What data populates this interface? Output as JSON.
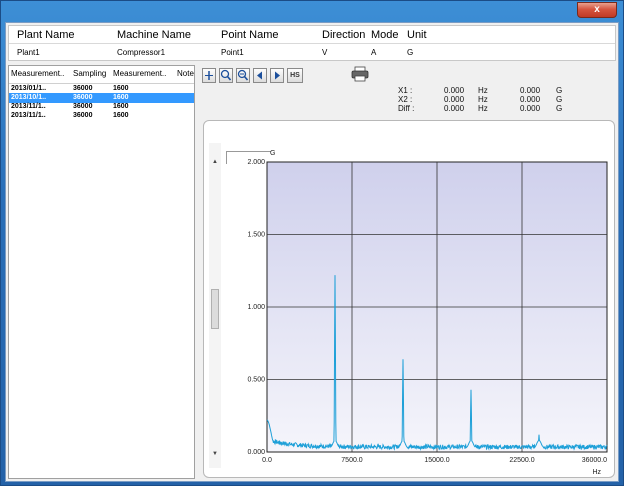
{
  "window": {
    "close_label": "x"
  },
  "header": {
    "columns": [
      "Plant Name",
      "Machine Name",
      "Point Name",
      "Direction",
      "Mode",
      "Unit"
    ],
    "values": [
      "Plant1",
      "Compressor1",
      "Point1",
      "V",
      "A",
      "G"
    ]
  },
  "measurements": {
    "columns": [
      "Measurement..",
      "Sampling",
      "Measurement..",
      "Note"
    ],
    "rows": [
      {
        "date": "2013/01/1..",
        "sampling": "36000",
        "lines": "1600",
        "selected": false
      },
      {
        "date": "2013/10/1..",
        "sampling": "36000",
        "lines": "1600",
        "selected": true
      },
      {
        "date": "2013/11/1..",
        "sampling": "36000",
        "lines": "1600",
        "selected": false
      },
      {
        "date": "2013/11/1..",
        "sampling": "36000",
        "lines": "1600",
        "selected": false
      }
    ]
  },
  "toolbar": {
    "hs_label": "HS"
  },
  "readout": {
    "x1_label": "X1 :",
    "x1_value": "0.000",
    "x1_unit": "Hz",
    "x1_amp": "0.000",
    "x1_amp_unit": "G",
    "x2_label": "X2 :",
    "x2_value": "0.000",
    "x2_unit": "Hz",
    "x2_amp": "0.000",
    "x2_amp_unit": "G",
    "diff_label": "Diff :",
    "diff_value": "0.000",
    "diff_unit": "Hz",
    "diff_amp": "0.000",
    "diff_amp_unit": "G"
  },
  "chart_data": {
    "type": "line",
    "ylabel": "G",
    "xlabel": "Hz",
    "xlim": [
      0,
      36000
    ],
    "ylim": [
      0,
      2.0
    ],
    "x_ticks": [
      "0.0",
      "7500.0",
      "15000.0",
      "22500.0",
      "36000.0"
    ],
    "y_ticks": [
      "0.000",
      "0.500",
      "1.000",
      "1.500",
      "2.000"
    ],
    "grid": true,
    "peaks": [
      {
        "x": 0,
        "y": 0.22
      },
      {
        "x": 7200,
        "y": 1.22
      },
      {
        "x": 14400,
        "y": 0.64
      },
      {
        "x": 21600,
        "y": 0.43
      },
      {
        "x": 28800,
        "y": 0.12
      }
    ],
    "colors": {
      "line": "#1ea0d8",
      "plot_bg_top": "#cfd0ec",
      "plot_bg_bottom": "#f5f5fb",
      "grid": "#333333"
    }
  }
}
